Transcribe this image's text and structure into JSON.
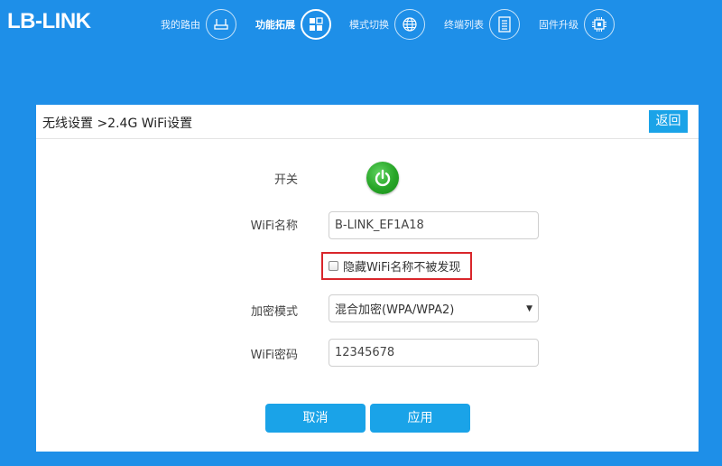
{
  "brand": {
    "logo_text": "LB-LINK"
  },
  "nav": {
    "items": [
      {
        "label": "我的路由",
        "icon": "router-icon",
        "active": false
      },
      {
        "label": "功能拓展",
        "icon": "grid-icon",
        "active": true
      },
      {
        "label": "模式切换",
        "icon": "globe-icon",
        "active": false
      },
      {
        "label": "终端列表",
        "icon": "list-icon",
        "active": false
      },
      {
        "label": "固件升级",
        "icon": "chip-icon",
        "active": false
      }
    ]
  },
  "panel": {
    "breadcrumb": "无线设置 >2.4G WiFi设置",
    "back_label": "返回"
  },
  "form": {
    "switch_label": "开关",
    "switch_on": true,
    "ssid_label": "WiFi名称",
    "ssid_value": "B-LINK_EF1A18",
    "hide_ssid_label": "隐藏WiFi名称不被发现",
    "hide_ssid_checked": false,
    "encryption_label": "加密模式",
    "encryption_value": "混合加密(WPA/WPA2)",
    "password_label": "WiFi密码",
    "password_value": "12345678"
  },
  "actions": {
    "cancel_label": "取消",
    "apply_label": "应用"
  },
  "colors": {
    "background": "#1e8fe8",
    "button": "#1aa3e8",
    "power_on": "#27a527",
    "highlight_border": "#d9262b"
  }
}
